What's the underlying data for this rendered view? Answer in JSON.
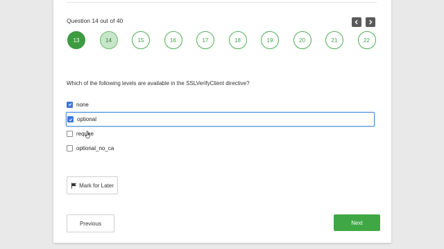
{
  "header": {
    "question_counter": "Question 14 out of 40"
  },
  "navigation": {
    "prev_icon": "chevron-left-icon",
    "next_icon": "chevron-right-icon",
    "questions": [
      {
        "number": "13",
        "state": "current"
      },
      {
        "number": "14",
        "state": "visited"
      },
      {
        "number": "15",
        "state": "unvisited"
      },
      {
        "number": "16",
        "state": "unvisited"
      },
      {
        "number": "17",
        "state": "unvisited"
      },
      {
        "number": "18",
        "state": "unvisited"
      },
      {
        "number": "19",
        "state": "unvisited"
      },
      {
        "number": "20",
        "state": "unvisited"
      },
      {
        "number": "21",
        "state": "unvisited"
      },
      {
        "number": "22",
        "state": "unvisited"
      }
    ]
  },
  "question": {
    "text": "Which of the following levels are available in the SSLVerifyClient directive?",
    "options": [
      {
        "label": "none",
        "checked": true
      },
      {
        "label": "optional",
        "checked": true,
        "focused": true
      },
      {
        "label": "require",
        "checked": false
      },
      {
        "label": "optional_no_ca",
        "checked": false
      }
    ]
  },
  "actions": {
    "mark_for_later": "Mark for Later",
    "mark_icon": "flag-icon",
    "previous": "Previous",
    "next": "Next"
  },
  "colors": {
    "accent_green": "#3fa845",
    "current_circle": "#3d9b40",
    "visited_circle": "#c8e6c9",
    "focus_blue": "#4a90d9",
    "checkbox_blue": "#3b78d8"
  }
}
